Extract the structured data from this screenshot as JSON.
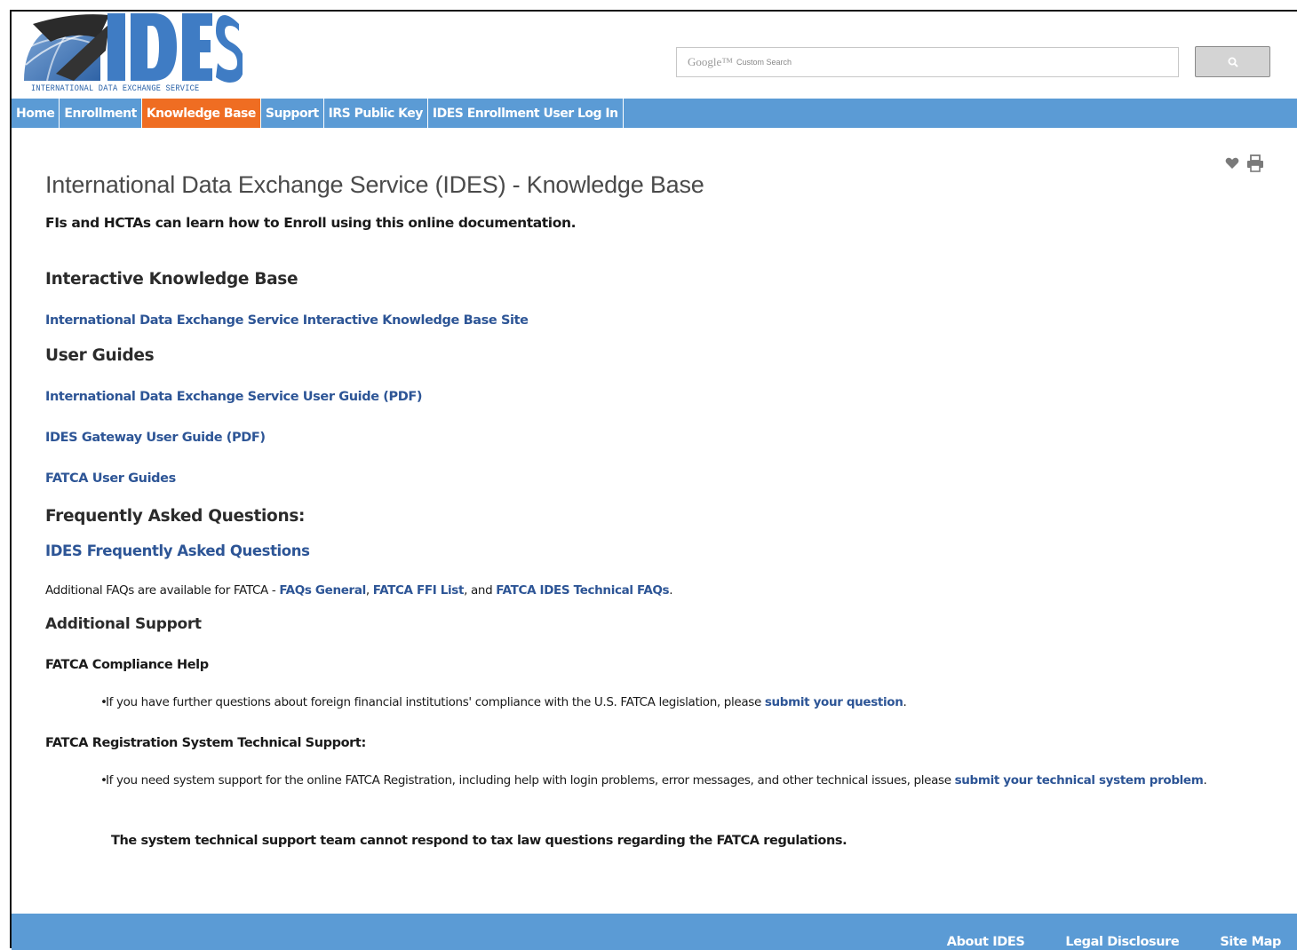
{
  "header": {
    "logo_text": "IDES",
    "logo_subtitle": "INTERNATIONAL DATA EXCHANGE SERVICE",
    "search_brand": "Google™",
    "search_placeholder": "Custom Search"
  },
  "nav": {
    "items": [
      {
        "label": "Home"
      },
      {
        "label": "Enrollment"
      },
      {
        "label": "Knowledge Base",
        "active": true
      },
      {
        "label": "Support"
      },
      {
        "label": "IRS Public Key"
      },
      {
        "label": "IDES Enrollment User Log In"
      }
    ]
  },
  "page": {
    "title": "International Data Exchange Service (IDES) - Knowledge Base",
    "subtitle": "FIs and HCTAs can learn how to Enroll using this online documentation.",
    "sections": {
      "interactive_kb": {
        "heading": "Interactive Knowledge Base",
        "link": "International Data Exchange Service Interactive Knowledge Base Site"
      },
      "user_guides": {
        "heading": "User Guides",
        "links": [
          "International Data Exchange Service User Guide (PDF)",
          "IDES Gateway User Guide (PDF)",
          "FATCA User Guides"
        ]
      },
      "faq": {
        "heading": "Frequently Asked Questions:",
        "link": "IDES Frequently Asked Questions",
        "additional_prefix": "Additional FAQs are available for FATCA - ",
        "additional_link1": "FAQs General",
        "additional_sep1": ", ",
        "additional_link2": "FATCA FFI List",
        "additional_sep2": ", and ",
        "additional_link3": "FATCA IDES Technical FAQs",
        "additional_suffix": "."
      },
      "support": {
        "heading": "Additional Support",
        "compliance_heading": "FATCA Compliance Help",
        "compliance_text": "If you have further questions about foreign financial institutions' compliance with the U.S. FATCA legislation, please ",
        "compliance_link": "submit your question",
        "compliance_suffix": ".",
        "tech_heading": "FATCA Registration System Technical Support:",
        "tech_text": "If you need system support for the online FATCA Registration, including help with login problems, error messages, and other technical issues, please ",
        "tech_link": "submit your technical system problem",
        "tech_suffix": ".",
        "tech_note": "The system technical support team cannot respond to tax law questions regarding the FATCA regulations."
      }
    }
  },
  "footer": {
    "links": [
      "About IDES",
      "Legal Disclosure",
      "Site Map"
    ]
  },
  "colors": {
    "nav_bg": "#5b9bd5",
    "nav_active": "#ef6d22",
    "link": "#2d5596"
  }
}
